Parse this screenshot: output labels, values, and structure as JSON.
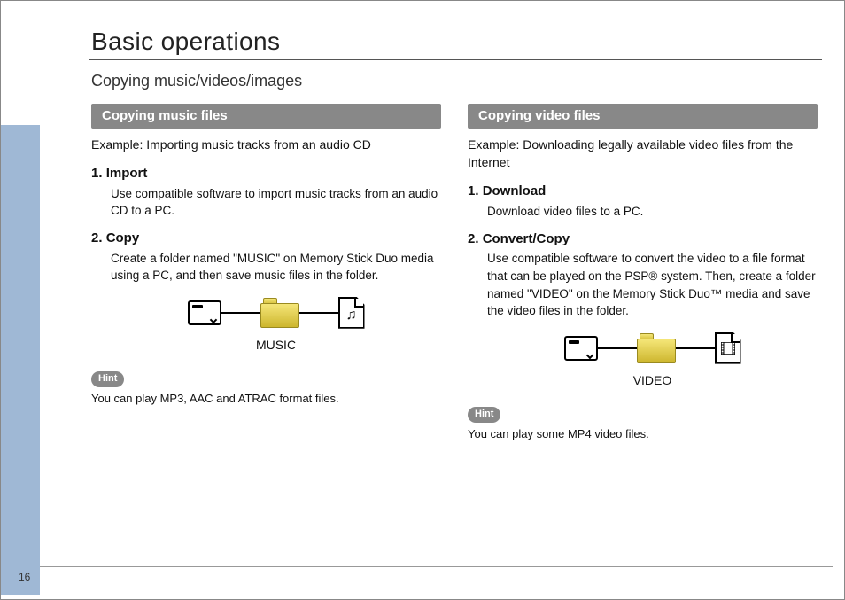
{
  "pageNumber": "16",
  "header": {
    "title": "Basic operations",
    "subtitle": "Copying music/videos/images"
  },
  "left": {
    "sectionTitle": "Copying music files",
    "example": "Example: Importing music tracks from an audio CD",
    "step1": {
      "num": "1.",
      "title": "Import",
      "body": "Use compatible software to import music tracks from an audio CD to a PC."
    },
    "step2": {
      "num": "2.",
      "title": "Copy",
      "body": "Create a folder named \"MUSIC\" on Memory Stick Duo media using a PC, and then save music files in the folder."
    },
    "folderLabel": "MUSIC",
    "hintLabel": "Hint",
    "hintText": "You can play MP3, AAC and ATRAC format files."
  },
  "right": {
    "sectionTitle": "Copying video files",
    "example": "Example: Downloading legally available video files from the Internet",
    "step1": {
      "num": "1.",
      "title": "Download",
      "body": "Download video files to a PC."
    },
    "step2": {
      "num": "2.",
      "title": "Convert/Copy",
      "body": "Use compatible software to convert the video to a file format that can be played on the PSP® system. Then, create a folder named \"VIDEO\" on the Memory Stick Duo™ media and save the video files in the folder."
    },
    "folderLabel": "VIDEO",
    "hintLabel": "Hint",
    "hintText": "You can play some MP4 video files."
  }
}
